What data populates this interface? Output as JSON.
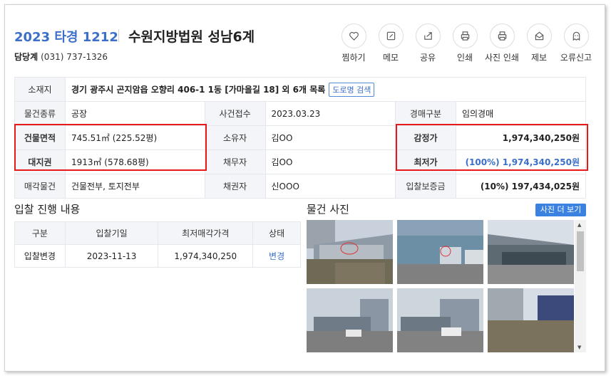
{
  "header": {
    "case_no": "2023 타경 1212",
    "court": "수원지방법원 성남6계",
    "contact_label": "담당계",
    "contact_phone": "(031) 737-1326"
  },
  "actions": [
    {
      "label": "찜하기",
      "icon": "heart-icon"
    },
    {
      "label": "메모",
      "icon": "memo-icon"
    },
    {
      "label": "공유",
      "icon": "share-icon"
    },
    {
      "label": "인쇄",
      "icon": "print-icon"
    },
    {
      "label": "사진 인쇄",
      "icon": "photo-print-icon"
    },
    {
      "label": "제보",
      "icon": "report-icon"
    },
    {
      "label": "오류신고",
      "icon": "ghost-icon"
    }
  ],
  "info": {
    "location_label": "소재지",
    "location_value": "경기 광주시 곤지암읍 오향리 406-1 1동 [가마을길 18] 외 6개 목록",
    "road_search": "도로명 검색",
    "type_label": "물건종류",
    "type_value": "공장",
    "received_label": "사건접수",
    "received_value": "2023.03.23",
    "auction_type_label": "경매구분",
    "auction_type_value": "임의경매",
    "building_label": "건물면적",
    "building_value": "745.51㎡ (225.52평)",
    "owner_label": "소유자",
    "owner_value": "김OO",
    "appraisal_label": "감정가",
    "appraisal_value": "1,974,340,250원",
    "land_label": "대지권",
    "land_value": "1913㎡ (578.68평)",
    "debtor_label": "채무자",
    "debtor_value": "김OO",
    "min_price_label": "최저가",
    "min_price_value": "(100%) 1,974,340,250원",
    "sale_items_label": "매각물건",
    "sale_items_value": "건물전부, 토지전부",
    "creditor_label": "채권자",
    "creditor_value": "신OOO",
    "deposit_label": "입찰보증금",
    "deposit_value": "(10%) 197,434,025원"
  },
  "bids": {
    "title": "입찰 진행 내용",
    "headers": [
      "구분",
      "입찰기일",
      "최저매각가격",
      "상태"
    ],
    "rows": [
      {
        "kind": "입찰변경",
        "date": "2023-11-13",
        "price": "1,974,340,250",
        "status": "변경"
      }
    ]
  },
  "photos": {
    "title": "물건 사진",
    "more_button": "사진 더 보기",
    "count": 6
  },
  "colors": {
    "accent": "#3b6fc9",
    "highlight_box": "#e81919",
    "more_button_bg": "#3b82e0"
  }
}
